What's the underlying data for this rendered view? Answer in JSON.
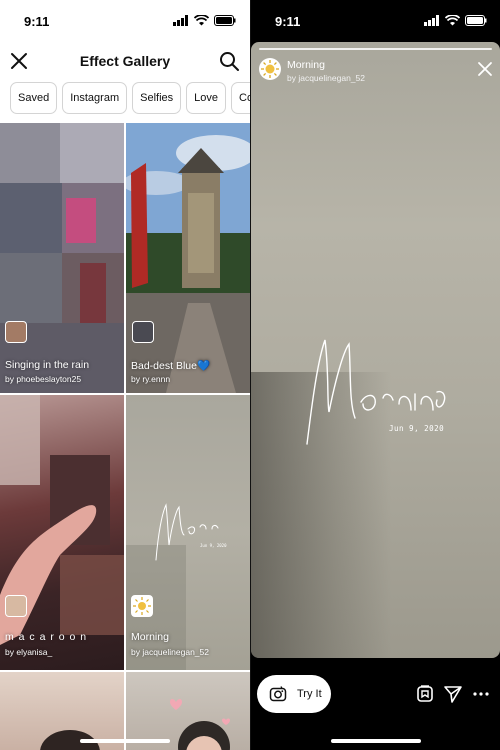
{
  "status_bar": {
    "time_left": "9:11",
    "time_right": "9:11"
  },
  "gallery": {
    "title": "Effect Gallery",
    "chips": [
      "Saved",
      "Instagram",
      "Selfies",
      "Love",
      "Color & l"
    ],
    "tiles": [
      {
        "name": "Singing in the rain",
        "creator": "by phoebeslayton25"
      },
      {
        "name": "Bad-dest Blue💙",
        "creator": "by ry.ennn"
      },
      {
        "name": "m a c a r o o n",
        "creator": "by elyanisa_"
      },
      {
        "name": "Morning",
        "creator": "by jacquelinegan_52"
      }
    ]
  },
  "story": {
    "title": "Morning",
    "creator": "by jacquelinegan_52",
    "date": "Jun 9, 2020"
  },
  "actions": {
    "try_it_label": "Try It"
  },
  "icons": {
    "close": "close-icon",
    "search": "search-icon",
    "camera": "camera-icon",
    "save": "save-icon",
    "send": "send-icon",
    "more": "more-icon"
  },
  "colors": {
    "chip_border": "#d4d4d4",
    "story_bg": "#aeab9f",
    "background": "#000000"
  }
}
